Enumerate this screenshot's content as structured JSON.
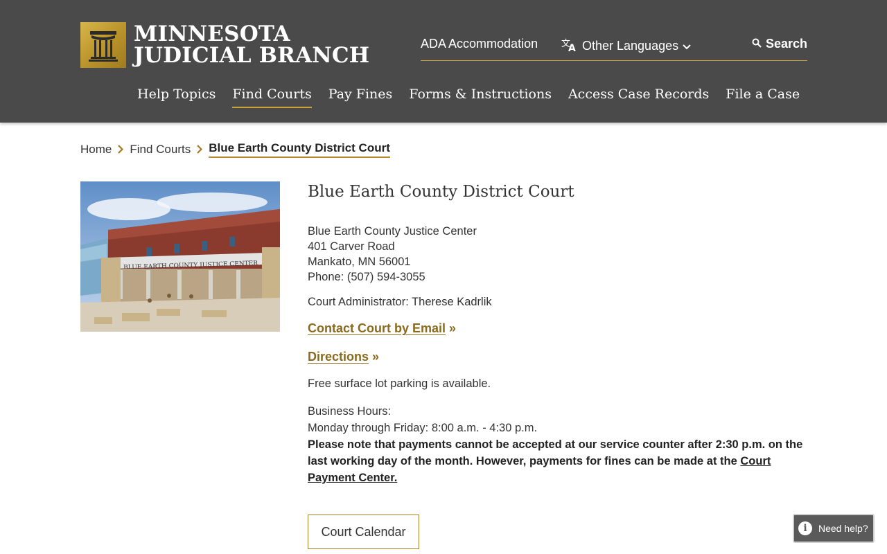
{
  "header": {
    "logo_line1": "MINNESOTA",
    "logo_line2": "JUDICIAL BRANCH",
    "utility": {
      "ada": "ADA Accommodation",
      "languages": "Other Languages",
      "search": "Search"
    },
    "nav": [
      {
        "label": "Help Topics",
        "active": false
      },
      {
        "label": "Find Courts",
        "active": true
      },
      {
        "label": "Pay Fines",
        "active": false
      },
      {
        "label": "Forms & Instructions",
        "active": false
      },
      {
        "label": "Access Case Records",
        "active": false
      },
      {
        "label": "File a Case",
        "active": false
      }
    ]
  },
  "breadcrumb": [
    {
      "label": "Home"
    },
    {
      "label": "Find Courts"
    },
    {
      "label": "Blue Earth County District Court"
    }
  ],
  "photo": {
    "sign_text": "BLUE EARTH COUNTY JUSTICE CENTER"
  },
  "court": {
    "title": "Blue Earth County District Court",
    "address": [
      "Blue Earth County Justice Center",
      "401 Carver Road",
      "Mankato, MN 56001",
      "Phone: (507) 594-3055"
    ],
    "administrator": "Court Administrator: Therese Kadrlik",
    "contact_link": "Contact Court by Email",
    "directions_link": "Directions",
    "link_suffix": " »",
    "parking": "Free surface lot parking is available.",
    "hours_label": "Business Hours:",
    "hours": "Monday through Friday: 8:00 a.m. - 4:30 p.m.",
    "note_text": "Please note that payments cannot be accepted at our service counter after 2:30 p.m. on the last working day of the month. However, payments for fines can be made at the ",
    "note_link": "Court Payment Center.",
    "calendar_button": "Court Calendar"
  },
  "help": {
    "label": "Need help?"
  },
  "colors": {
    "header_bg": "#4a4a4a",
    "accent_gold": "#c9a23a",
    "link_gold": "#8a6a1e"
  }
}
